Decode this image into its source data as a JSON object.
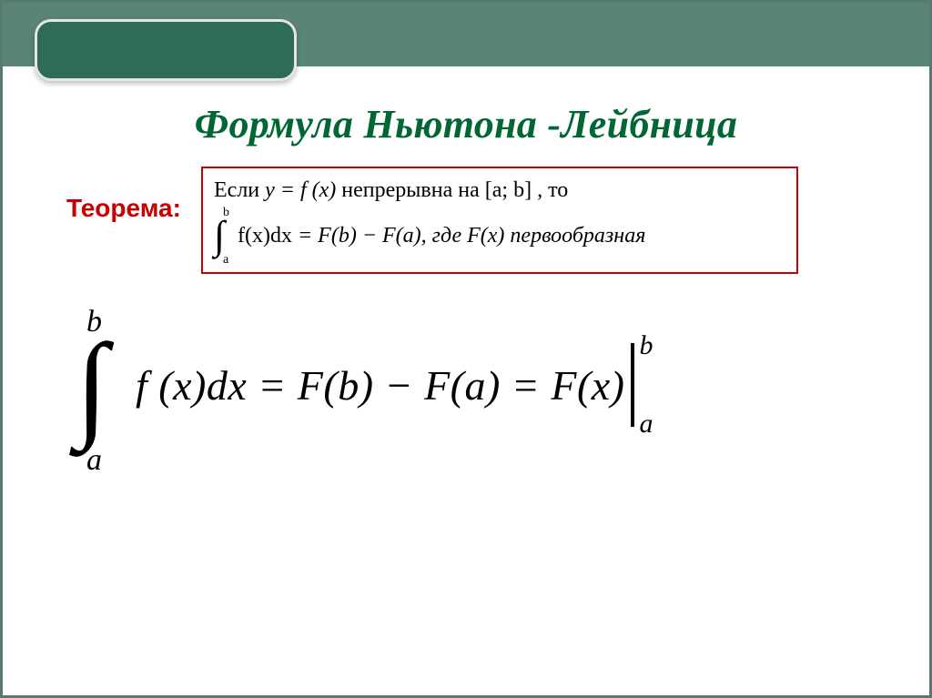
{
  "title": "Формула Ньютона -Лейбница",
  "theorem_label": "Теорема:",
  "theorem": {
    "line1_prefix": "Если ",
    "line1_eq": "y = f (x)",
    "line1_mid": " непрерывна на ",
    "line1_interval": "[a; b]",
    "line1_suffix": ", то",
    "int_lower": "a",
    "int_upper": "b",
    "line2_lhs": "f(x)dx",
    "line2_rhs": " = F(b) − F(a), где F(x) первообразная"
  },
  "formula": {
    "int_lower": "a",
    "int_upper": "b",
    "body": "f (x)dx = F(b) − F(a) = F(x)",
    "eval_lower": "a",
    "eval_upper": "b"
  }
}
